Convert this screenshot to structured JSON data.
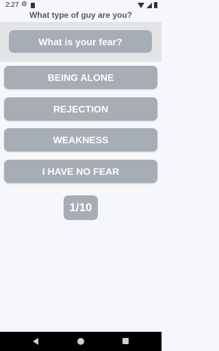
{
  "status_bar": {
    "time": "2:27",
    "icons": [
      "gear-icon",
      "sd-card-icon",
      "wifi-icon",
      "signal-icon",
      "battery-icon"
    ]
  },
  "app": {
    "title": "What type of guy are you?"
  },
  "question": {
    "text": "What is your fear?"
  },
  "answers": [
    {
      "label": "BEING ALONE"
    },
    {
      "label": "REJECTION"
    },
    {
      "label": "WEAKNESS"
    },
    {
      "label": "I HAVE NO FEAR"
    }
  ],
  "progress": {
    "text": "1/10"
  },
  "colors": {
    "button_bg": "#a6adb5",
    "button_text": "#ffffff",
    "band_bg": "#e3e4e6",
    "page_bg": "#f5f7fa",
    "title_text": "#555a60"
  },
  "nav_bar": {
    "icons": [
      "back-icon",
      "home-icon",
      "recents-icon"
    ]
  }
}
